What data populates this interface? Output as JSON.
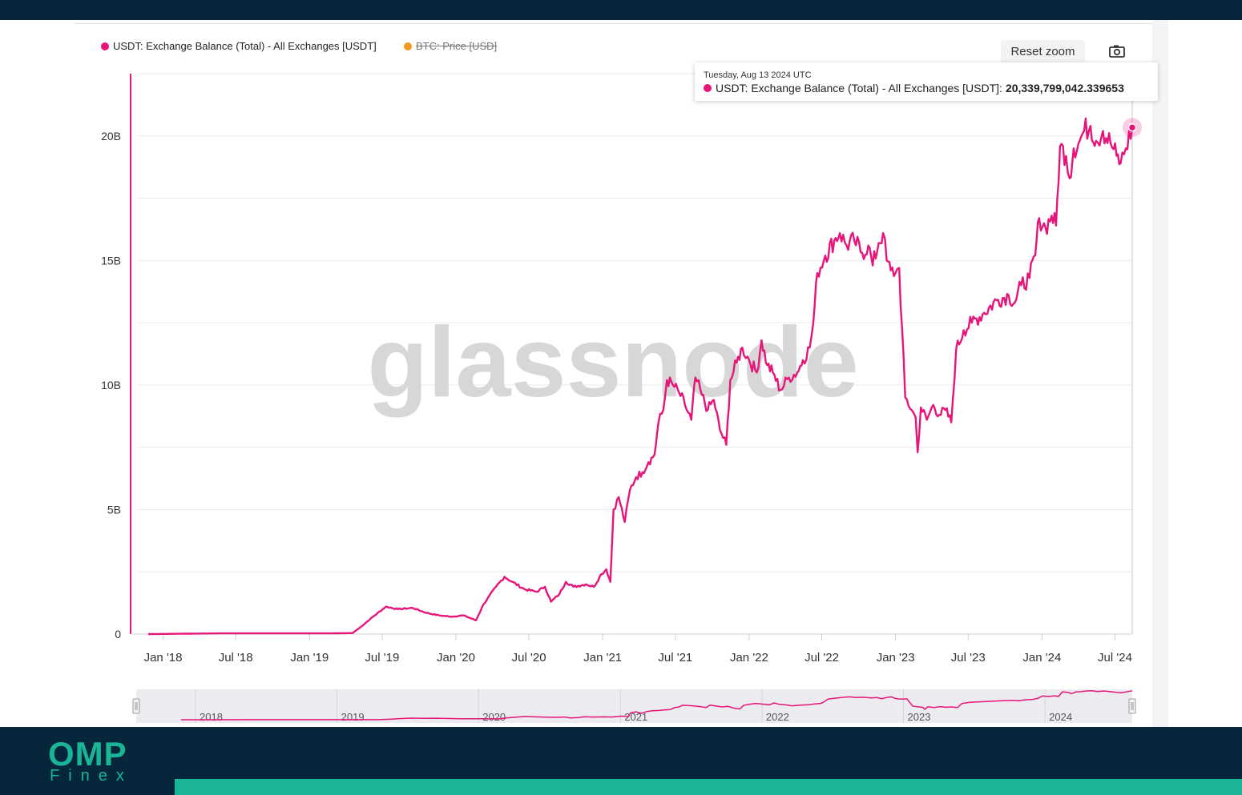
{
  "legend": {
    "series1": "USDT: Exchange Balance (Total) - All Exchanges [USDT]",
    "series2": "BTC: Price [USD]"
  },
  "controls": {
    "reset_zoom": "Reset zoom",
    "camera_icon": "camera-icon"
  },
  "tooltip": {
    "date": "Tuesday, Aug 13 2024 UTC",
    "label": "USDT: Exchange Balance (Total) - All Exchanges [USDT]:",
    "value": "20,339,799,042.339653"
  },
  "watermark": "glassnode",
  "logo": {
    "main": "OMP",
    "sub": "Finex"
  },
  "colors": {
    "series1": "#e6157a",
    "series2": "#f39a1e",
    "brand_dark": "#06263b",
    "brand_green": "#19b596"
  },
  "chart_data": {
    "type": "line",
    "ylim": [
      0,
      22500000000
    ],
    "yticks": [
      {
        "value": 0,
        "label": "0"
      },
      {
        "value": 5000000000,
        "label": "5B"
      },
      {
        "value": 10000000000,
        "label": "10B"
      },
      {
        "value": 15000000000,
        "label": "15B"
      },
      {
        "value": 20000000000,
        "label": "20B"
      }
    ],
    "xticks": [
      "Jan '18",
      "Jul '18",
      "Jan '19",
      "Jul '19",
      "Jan '20",
      "Jul '20",
      "Jan '21",
      "Jul '21",
      "Jan '22",
      "Jul '22",
      "Jan '23",
      "Jul '23",
      "Jan '24",
      "Jul '24"
    ],
    "navigator_labels": [
      "2018",
      "2019",
      "2020",
      "2021",
      "2022",
      "2023",
      "2024"
    ],
    "series": [
      {
        "name": "USDT: Exchange Balance (Total) - All Exchanges [USDT]",
        "points": [
          [
            "2017-11-25",
            0
          ],
          [
            "2018-06-01",
            30000000
          ],
          [
            "2019-03-01",
            30000000
          ],
          [
            "2019-04-18",
            40000000
          ],
          [
            "2019-05-10",
            300000000
          ],
          [
            "2019-06-01",
            600000000
          ],
          [
            "2019-07-10",
            1100000000
          ],
          [
            "2019-08-10",
            1000000000
          ],
          [
            "2019-09-15",
            1050000000
          ],
          [
            "2019-10-20",
            850000000
          ],
          [
            "2019-11-20",
            750000000
          ],
          [
            "2019-12-20",
            700000000
          ],
          [
            "2020-01-20",
            750000000
          ],
          [
            "2020-02-20",
            550000000
          ],
          [
            "2020-03-10",
            1200000000
          ],
          [
            "2020-04-10",
            1900000000
          ],
          [
            "2020-05-01",
            2300000000
          ],
          [
            "2020-05-20",
            2100000000
          ],
          [
            "2020-06-20",
            1800000000
          ],
          [
            "2020-07-20",
            1700000000
          ],
          [
            "2020-08-10",
            1900000000
          ],
          [
            "2020-08-25",
            1300000000
          ],
          [
            "2020-09-15",
            1600000000
          ],
          [
            "2020-10-01",
            2100000000
          ],
          [
            "2020-10-20",
            1900000000
          ],
          [
            "2020-11-20",
            2000000000
          ],
          [
            "2020-12-10",
            1900000000
          ],
          [
            "2020-12-28",
            2400000000
          ],
          [
            "2021-01-10",
            2600000000
          ],
          [
            "2021-01-20",
            2100000000
          ],
          [
            "2021-01-28",
            5000000000
          ],
          [
            "2021-02-10",
            5500000000
          ],
          [
            "2021-02-25",
            4500000000
          ],
          [
            "2021-03-10",
            5800000000
          ],
          [
            "2021-03-25",
            6300000000
          ],
          [
            "2021-04-10",
            6500000000
          ],
          [
            "2021-04-25",
            6900000000
          ],
          [
            "2021-05-10",
            7200000000
          ],
          [
            "2021-05-20",
            8500000000
          ],
          [
            "2021-06-01",
            9000000000
          ],
          [
            "2021-06-10",
            10200000000
          ],
          [
            "2021-06-25",
            10000000000
          ],
          [
            "2021-07-10",
            9700000000
          ],
          [
            "2021-07-25",
            9200000000
          ],
          [
            "2021-08-10",
            8600000000
          ],
          [
            "2021-08-20",
            10300000000
          ],
          [
            "2021-09-05",
            9600000000
          ],
          [
            "2021-09-20",
            9000000000
          ],
          [
            "2021-10-05",
            9400000000
          ],
          [
            "2021-10-20",
            8200000000
          ],
          [
            "2021-11-05",
            7600000000
          ],
          [
            "2021-11-15",
            10200000000
          ],
          [
            "2021-12-01",
            10900000000
          ],
          [
            "2021-12-15",
            11500000000
          ],
          [
            "2022-01-01",
            11000000000
          ],
          [
            "2022-01-20",
            10500000000
          ],
          [
            "2022-02-01",
            11800000000
          ],
          [
            "2022-02-15",
            10800000000
          ],
          [
            "2022-03-01",
            10500000000
          ],
          [
            "2022-03-20",
            9800000000
          ],
          [
            "2022-04-10",
            10300000000
          ],
          [
            "2022-05-01",
            10500000000
          ],
          [
            "2022-05-15",
            11000000000
          ],
          [
            "2022-06-01",
            11500000000
          ],
          [
            "2022-06-10",
            12500000000
          ],
          [
            "2022-06-20",
            14500000000
          ],
          [
            "2022-07-10",
            15200000000
          ],
          [
            "2022-08-01",
            15800000000
          ],
          [
            "2022-08-15",
            16100000000
          ],
          [
            "2022-09-01",
            15600000000
          ],
          [
            "2022-09-20",
            15800000000
          ],
          [
            "2022-10-10",
            15300000000
          ],
          [
            "2022-10-25",
            15600000000
          ],
          [
            "2022-11-05",
            14800000000
          ],
          [
            "2022-11-20",
            15700000000
          ],
          [
            "2022-12-01",
            16100000000
          ],
          [
            "2022-12-10",
            15000000000
          ],
          [
            "2022-12-20",
            14600000000
          ],
          [
            "2023-01-01",
            14500000000
          ],
          [
            "2023-01-10",
            14700000000
          ],
          [
            "2023-01-25",
            9500000000
          ],
          [
            "2023-02-10",
            9000000000
          ],
          [
            "2023-02-20",
            8700000000
          ],
          [
            "2023-02-25",
            7300000000
          ],
          [
            "2023-03-05",
            9100000000
          ],
          [
            "2023-03-20",
            8600000000
          ],
          [
            "2023-04-05",
            9200000000
          ],
          [
            "2023-04-20",
            8800000000
          ],
          [
            "2023-05-05",
            9000000000
          ],
          [
            "2023-05-20",
            8500000000
          ],
          [
            "2023-06-01",
            11400000000
          ],
          [
            "2023-06-20",
            12200000000
          ],
          [
            "2023-07-10",
            12500000000
          ],
          [
            "2023-08-10",
            12900000000
          ],
          [
            "2023-09-10",
            13400000000
          ],
          [
            "2023-10-10",
            13600000000
          ],
          [
            "2023-10-25",
            13300000000
          ],
          [
            "2023-11-10",
            14000000000
          ],
          [
            "2023-12-01",
            14300000000
          ],
          [
            "2023-12-15",
            15200000000
          ],
          [
            "2023-12-25",
            16700000000
          ],
          [
            "2024-01-10",
            16300000000
          ],
          [
            "2024-01-25",
            16800000000
          ],
          [
            "2024-02-05",
            16400000000
          ],
          [
            "2024-02-15",
            19600000000
          ],
          [
            "2024-03-01",
            19200000000
          ],
          [
            "2024-03-10",
            18300000000
          ],
          [
            "2024-03-20",
            19500000000
          ],
          [
            "2024-04-01",
            19700000000
          ],
          [
            "2024-04-15",
            20200000000
          ],
          [
            "2024-05-01",
            20400000000
          ],
          [
            "2024-05-15",
            19800000000
          ],
          [
            "2024-06-01",
            20200000000
          ],
          [
            "2024-06-20",
            19700000000
          ],
          [
            "2024-07-05",
            19200000000
          ],
          [
            "2024-07-15",
            18900000000
          ],
          [
            "2024-07-28",
            19500000000
          ],
          [
            "2024-08-13",
            20339799042
          ]
        ]
      },
      {
        "name": "BTC: Price [USD]",
        "hidden": true,
        "points": []
      }
    ]
  }
}
